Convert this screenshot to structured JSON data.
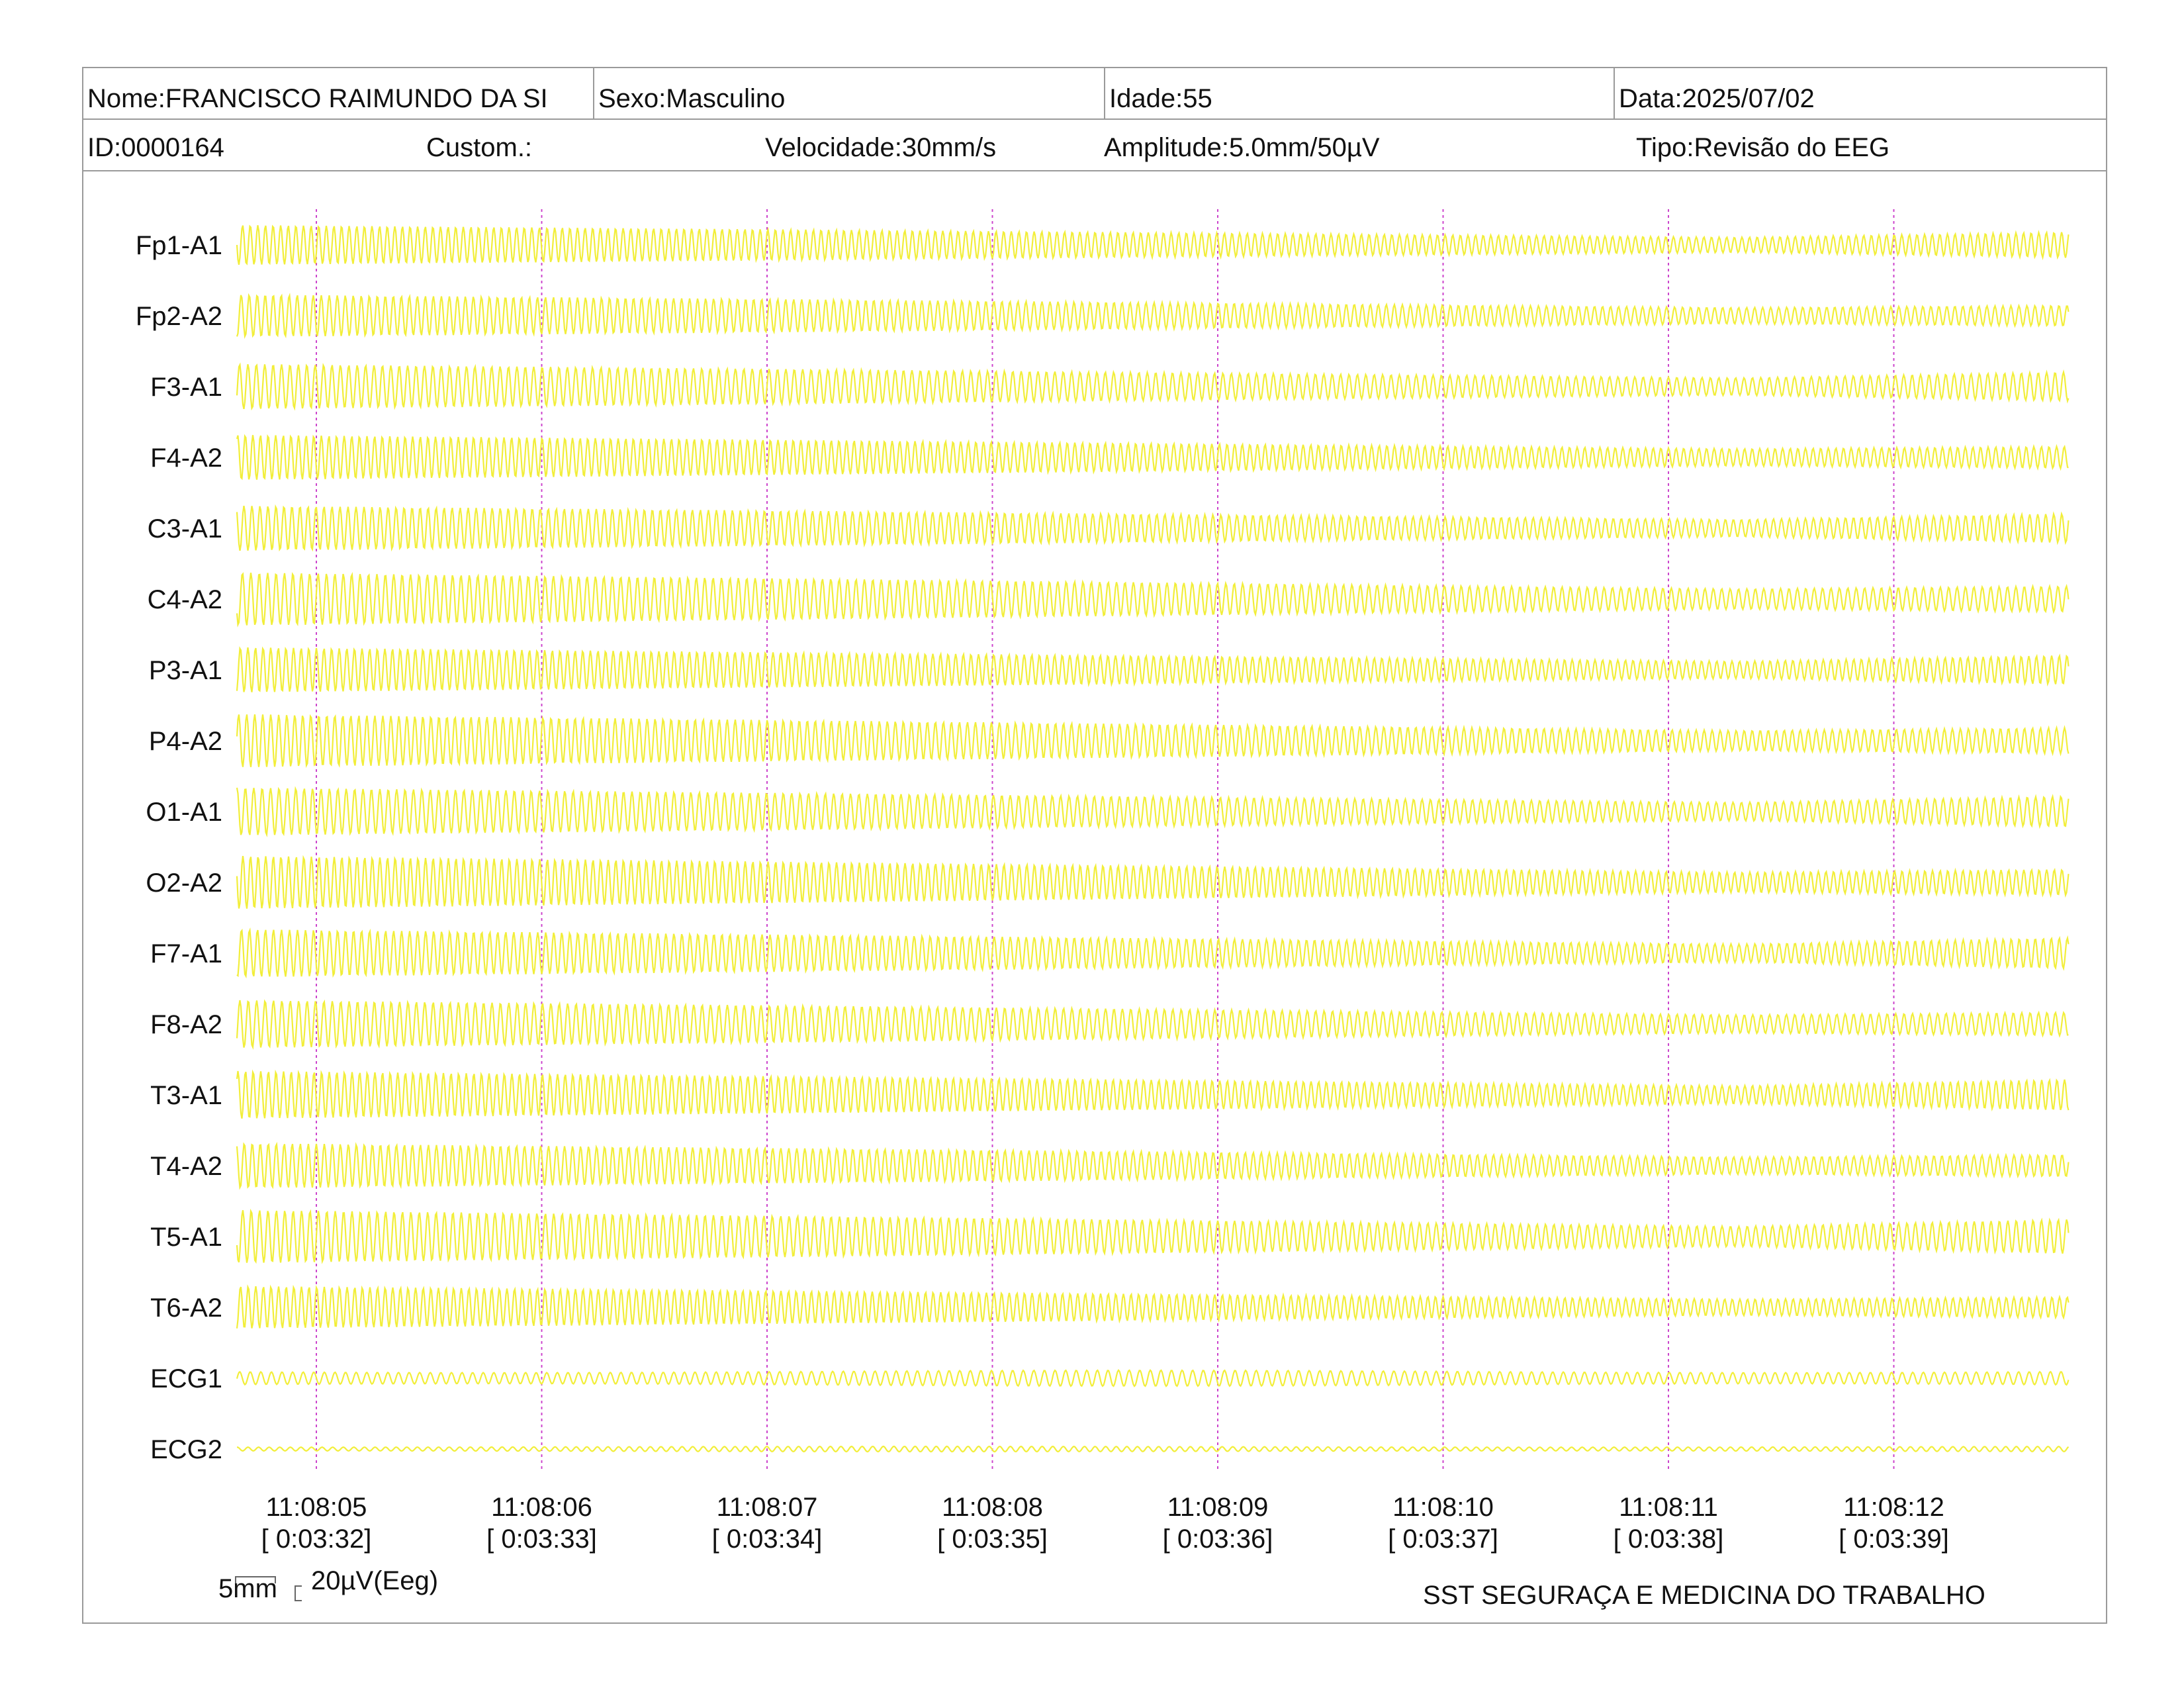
{
  "header": {
    "nome": "Nome:FRANCISCO RAIMUNDO DA SI",
    "sexo": "Sexo:Masculino",
    "idade": "Idade:55",
    "data": "Data:2025/07/02",
    "id": "ID:0000164",
    "custom": "Custom.:",
    "velocidade": "Velocidade:30mm/s",
    "amplitude": "Amplitude:5.0mm/50µV",
    "tipo": "Tipo:Revisão do EEG"
  },
  "colors": {
    "trace": "#f2ee3a",
    "gridline": "#cc44cc",
    "border": "#9a9a9a"
  },
  "chart_data": {
    "type": "line",
    "channels": [
      "Fp1-A1",
      "Fp2-A2",
      "F3-A1",
      "F4-A2",
      "C3-A1",
      "C4-A2",
      "P3-A1",
      "P4-A2",
      "O1-A1",
      "O2-A2",
      "F7-A1",
      "F8-A2",
      "T3-A1",
      "T4-A2",
      "T5-A1",
      "T6-A2",
      "ECG1",
      "ECG2"
    ],
    "time_ticks": [
      "11:08:05",
      "11:08:06",
      "11:08:07",
      "11:08:08",
      "11:08:09",
      "11:08:10",
      "11:08:11",
      "11:08:12"
    ],
    "elapsed_ticks": [
      "[ 0:03:32]",
      "[ 0:03:33]",
      "[ 0:03:34]",
      "[ 0:03:35]",
      "[ 0:03:36]",
      "[ 0:03:37]",
      "[ 0:03:38]",
      "[ 0:03:39]"
    ],
    "grid": true
  },
  "scale": {
    "mm": "5mm",
    "uv": "20µV(Eeg)"
  },
  "footer": "SST SEGURAÇA E MEDICINA DO TRABALHO"
}
